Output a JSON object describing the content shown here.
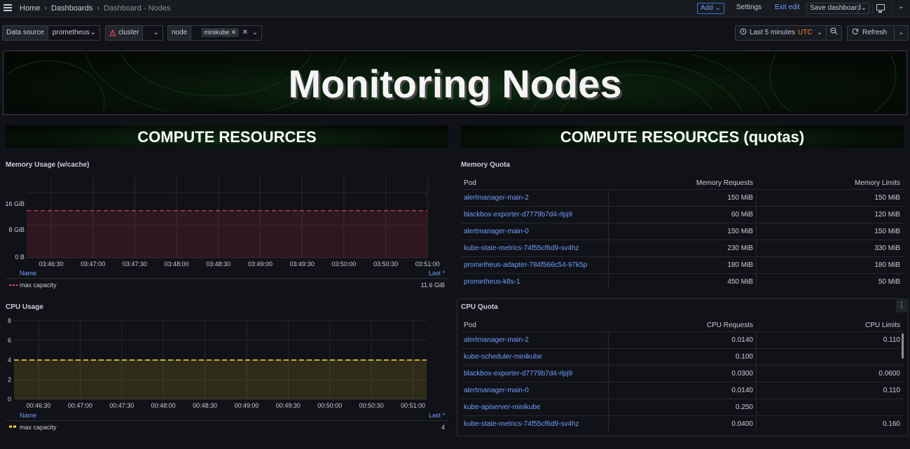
{
  "nav": {
    "breadcrumbs": [
      "Home",
      "Dashboards",
      "Dashboard - Nodes"
    ],
    "add_label": "Add",
    "settings_label": "Settings",
    "exit_edit_label": "Exit edit",
    "save_label": "Save dashboard"
  },
  "variables": {
    "datasource_label": "Data source",
    "datasource_value": "prometheus",
    "cluster_label": "cluster",
    "node_label": "node",
    "node_value": "minikube"
  },
  "time": {
    "range_label": "Last 5 minutes",
    "timezone": "UTC",
    "refresh_label": "Refresh"
  },
  "banner": {
    "title": "Monitoring Nodes"
  },
  "sections": {
    "left": "COMPUTE RESOURCES",
    "right": "COMPUTE RESOURCES (quotas)"
  },
  "memory_chart": {
    "title": "Memory Usage (w/cache)",
    "y_ticks": [
      "16 GiB",
      "8 GiB",
      "0 B"
    ],
    "x_ticks": [
      "03:46:30",
      "03:47:00",
      "03:47:30",
      "03:48:00",
      "03:48:30",
      "03:49:00",
      "03:49:30",
      "03:50:00",
      "03:50:30",
      "03:51:00"
    ],
    "legend_name_header": "Name",
    "legend_last_header": "Last *",
    "series_name": "max capacity",
    "series_last": "11.6 GiB",
    "color": "#f2495c"
  },
  "cpu_chart": {
    "title": "CPU Usage",
    "y_ticks": [
      "8",
      "6",
      "4",
      "2",
      "0"
    ],
    "x_ticks": [
      "00:46:30",
      "00:47:00",
      "00:47:30",
      "00:48:00",
      "00:48:30",
      "00:49:00",
      "00:49:30",
      "00:50:00",
      "00:50:30",
      "00:51:00"
    ],
    "legend_name_header": "Name",
    "legend_last_header": "Last *",
    "series_name": "max capacity",
    "series_last": "4",
    "color": "#fade2a"
  },
  "chart_data": [
    {
      "type": "line",
      "title": "Memory Usage (w/cache)",
      "ylabel": "",
      "y_unit": "GiB",
      "ylim": [
        0,
        20
      ],
      "x": [
        "03:46:30",
        "03:47:00",
        "03:47:30",
        "03:48:00",
        "03:48:30",
        "03:49:00",
        "03:49:30",
        "03:50:00",
        "03:50:30",
        "03:51:00"
      ],
      "series": [
        {
          "name": "max capacity",
          "values": [
            11.6,
            11.6,
            11.6,
            11.6,
            11.6,
            11.6,
            11.6,
            11.6,
            11.6,
            11.6
          ]
        }
      ]
    },
    {
      "type": "line",
      "title": "CPU Usage",
      "ylabel": "",
      "ylim": [
        0,
        8
      ],
      "x": [
        "00:46:30",
        "00:47:00",
        "00:47:30",
        "00:48:00",
        "00:48:30",
        "00:49:00",
        "00:49:30",
        "00:50:00",
        "00:50:30",
        "00:51:00"
      ],
      "series": [
        {
          "name": "max capacity",
          "values": [
            4,
            4,
            4,
            4,
            4,
            4,
            4,
            4,
            4,
            4
          ]
        }
      ]
    }
  ],
  "memory_quota": {
    "title": "Memory Quota",
    "headers": [
      "Pod",
      "Memory Requests",
      "Memory Limits"
    ],
    "rows": [
      [
        "alertmanager-main-2",
        "150 MiB",
        "150 MiB"
      ],
      [
        "blackbox-exporter-d7779b7d4-rlpj9",
        "60 MiB",
        "120 MiB"
      ],
      [
        "alertmanager-main-0",
        "150 MiB",
        "150 MiB"
      ],
      [
        "kube-state-metrics-74f55cf6d9-sv4hz",
        "230 MiB",
        "330 MiB"
      ],
      [
        "prometheus-adapter-784f566c54-97k5p",
        "180 MiB",
        "180 MiB"
      ],
      [
        "prometheus-k8s-1",
        "450 MiB",
        "50 MiB"
      ]
    ]
  },
  "cpu_quota": {
    "title": "CPU Quota",
    "headers": [
      "Pod",
      "CPU Requests",
      "CPU Limits"
    ],
    "rows": [
      [
        "alertmanager-main-2",
        "0.0140",
        "0.110"
      ],
      [
        "kube-scheduler-minikube",
        "0.100",
        ""
      ],
      [
        "blackbox-exporter-d7779b7d4-rlpj9",
        "0.0300",
        "0.0600"
      ],
      [
        "alertmanager-main-0",
        "0.0140",
        "0.110"
      ],
      [
        "kube-apiserver-minikube",
        "0.250",
        ""
      ],
      [
        "kube-state-metrics-74f55cf6d9-sv4hz",
        "0.0400",
        "0.160"
      ]
    ]
  }
}
